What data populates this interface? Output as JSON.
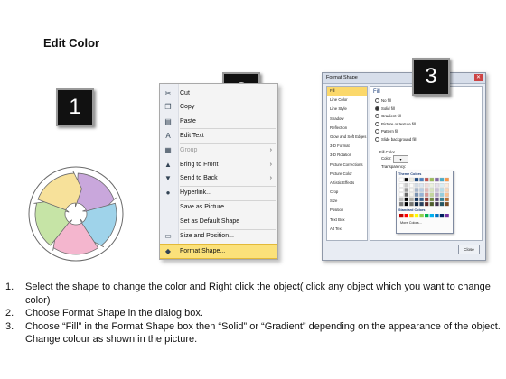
{
  "title": "Edit Color",
  "badges": [
    "1",
    "2",
    "3"
  ],
  "context_menu": {
    "items": [
      {
        "icon": "cut-icon",
        "label": "Cut",
        "submenu": false,
        "disabled": false,
        "highlighted": false
      },
      {
        "icon": "copy-icon",
        "label": "Copy",
        "submenu": false,
        "disabled": false,
        "highlighted": false
      },
      {
        "icon": "paste-icon",
        "label": "Paste",
        "submenu": false,
        "disabled": false,
        "highlighted": false
      },
      {
        "icon": "edit-text-icon",
        "label": "Edit Text",
        "submenu": false,
        "disabled": false,
        "highlighted": false
      },
      {
        "icon": "group-icon",
        "label": "Group",
        "submenu": true,
        "disabled": true,
        "highlighted": false
      },
      {
        "icon": "bring-to-front-icon",
        "label": "Bring to Front",
        "submenu": true,
        "disabled": false,
        "highlighted": false
      },
      {
        "icon": "send-to-back-icon",
        "label": "Send to Back",
        "submenu": true,
        "disabled": false,
        "highlighted": false
      },
      {
        "icon": "hyperlink-icon",
        "label": "Hyperlink...",
        "submenu": false,
        "disabled": false,
        "highlighted": false
      },
      {
        "icon": "",
        "label": "Save as Picture...",
        "submenu": false,
        "disabled": false,
        "highlighted": false
      },
      {
        "icon": "",
        "label": "Set as Default Shape",
        "submenu": false,
        "disabled": false,
        "highlighted": false
      },
      {
        "icon": "size-position-icon",
        "label": "Size and Position...",
        "submenu": false,
        "disabled": false,
        "highlighted": false
      },
      {
        "icon": "format-shape-icon",
        "label": "Format Shape...",
        "submenu": false,
        "disabled": false,
        "highlighted": true
      }
    ]
  },
  "dialog": {
    "title": "Format Shape",
    "categories": [
      "Fill",
      "Line Color",
      "Line Style",
      "Shadow",
      "Reflection",
      "Glow and Soft Edges",
      "3-D Format",
      "3-D Rotation",
      "Picture Corrections",
      "Picture Color",
      "Artistic Effects",
      "Crop",
      "Size",
      "Position",
      "Text Box",
      "Alt Text"
    ],
    "selected_category": "Fill",
    "panel_heading": "Fill",
    "fill_options": [
      "No fill",
      "Solid fill",
      "Gradient fill",
      "Picture or texture fill",
      "Pattern fill",
      "Slide background fill"
    ],
    "selected_fill": "Solid fill",
    "fill_color_label": "Fill Color",
    "color_label": "Color:",
    "transparency_label": "Transparency:",
    "palette_theme_label": "Theme Colors",
    "palette_standard_label": "Standard Colors",
    "palette_more": "More Colors...",
    "close_label": "Close",
    "theme_top_row": [
      "#ffffff",
      "#000000",
      "#eeece1",
      "#1f497d",
      "#4f81bd",
      "#c0504d",
      "#9bbb59",
      "#8064a2",
      "#4bacc6",
      "#f79646"
    ],
    "standard_colors": [
      "#c00000",
      "#ff0000",
      "#ffc000",
      "#ffff00",
      "#92d050",
      "#00b050",
      "#00b0f0",
      "#0070c0",
      "#002060",
      "#7030a0"
    ]
  },
  "wheel_colors": [
    "#c9a7dc",
    "#9fd3ea",
    "#f4b6ce",
    "#c6e4a6",
    "#f7e19a"
  ],
  "steps": [
    {
      "num": "1.",
      "text": "Select the shape to change the color and Right click the object( click any object which you want to change color)"
    },
    {
      "num": "2.",
      "text": "Choose Format Shape in the dialog box."
    },
    {
      "num": "3.",
      "text": "Choose “Fill” in the Format Shape box then “Solid” or “Gradient” depending on the appearance of the object. Change colour as shown in the picture."
    }
  ]
}
